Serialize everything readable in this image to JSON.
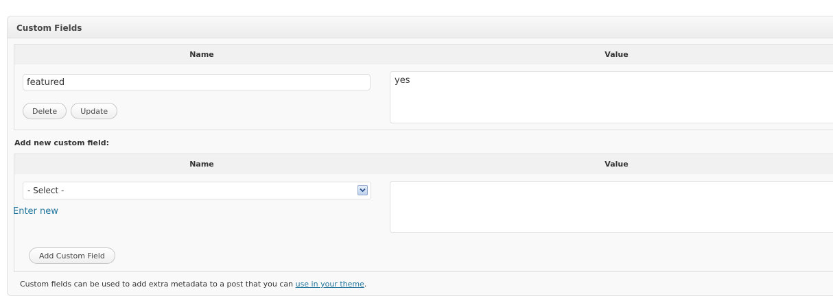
{
  "panel": {
    "title": "Custom Fields"
  },
  "existing": {
    "name_header": "Name",
    "value_header": "Value",
    "key_value": "featured",
    "value_value": "yes",
    "delete_label": "Delete",
    "update_label": "Update"
  },
  "new_field": {
    "heading": "Add new custom field:",
    "name_header": "Name",
    "value_header": "Value",
    "select_value": "- Select -",
    "enter_new_label": "Enter new",
    "add_label": "Add Custom Field",
    "value_text": ""
  },
  "footer": {
    "text": "Custom fields can be used to add extra metadata to a post that you can ",
    "link_label": "use in your theme",
    "suffix": "."
  }
}
